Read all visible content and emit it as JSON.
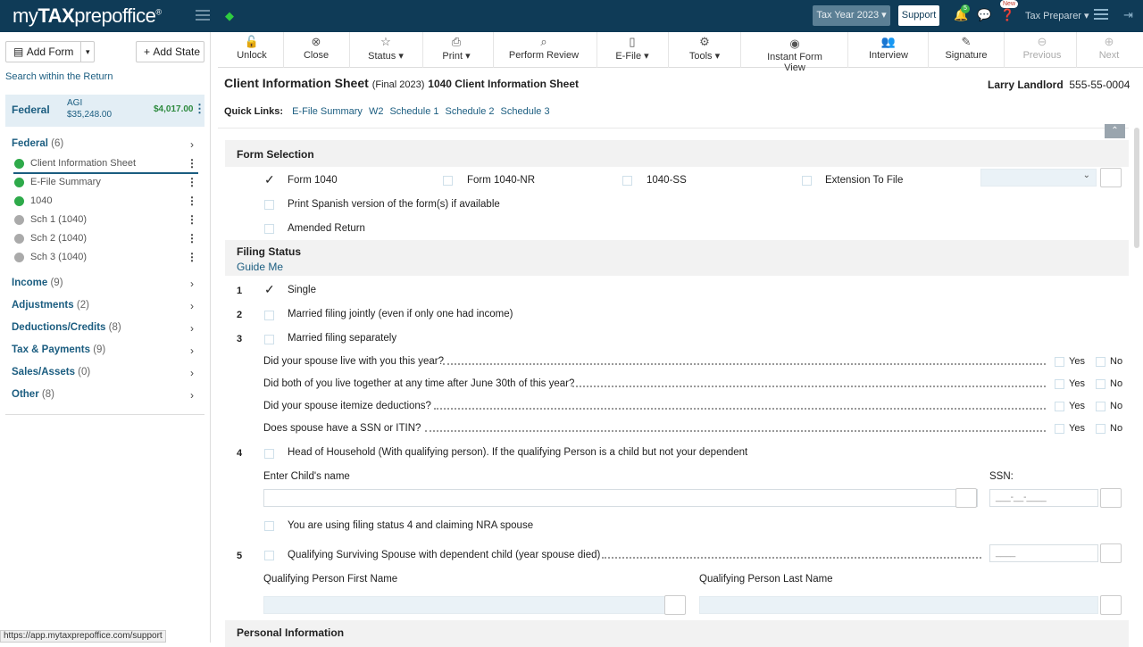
{
  "topbar": {
    "logo_pre": "my",
    "logo_mid": "TAX",
    "logo_post": "prepoffice",
    "logo_mark": "®",
    "tax_year": "Tax Year 2023 ▾",
    "support": "Support",
    "notif_count": "5",
    "new_label": "New",
    "preparer": "Tax Preparer ▾"
  },
  "sidebar": {
    "add_form": "Add Form",
    "add_state": "Add State",
    "search": "Search within the Return",
    "federal": {
      "title": "Federal",
      "agi_label": "AGI",
      "agi_value": "$35,248.00",
      "refund": "$4,017.00"
    },
    "federal_cat": {
      "label": "Federal",
      "count": "(6)"
    },
    "forms": [
      {
        "label": "Client Information Sheet",
        "status": "green"
      },
      {
        "label": "E-File Summary",
        "status": "green"
      },
      {
        "label": "1040",
        "status": "green"
      },
      {
        "label": "Sch 1 (1040)",
        "status": "gray"
      },
      {
        "label": "Sch 2 (1040)",
        "status": "gray"
      },
      {
        "label": "Sch 3 (1040)",
        "status": "gray"
      }
    ],
    "categories": [
      {
        "label": "Income",
        "count": "(9)"
      },
      {
        "label": "Adjustments",
        "count": "(2)"
      },
      {
        "label": "Deductions/Credits",
        "count": "(8)"
      },
      {
        "label": "Tax & Payments",
        "count": "(9)"
      },
      {
        "label": "Sales/Assets",
        "count": "(0)"
      },
      {
        "label": "Other",
        "count": "(8)"
      }
    ]
  },
  "toolbar": {
    "unlock": "Unlock",
    "close": "Close",
    "status": "Status ▾",
    "print": "Print ▾",
    "review": "Perform Review",
    "efile": "E-File ▾",
    "tools": "Tools ▾",
    "instant": "Instant Form View",
    "interview": "Interview",
    "signature": "Signature",
    "previous": "Previous",
    "next": "Next"
  },
  "header": {
    "title": "Client Information Sheet",
    "final": "(Final 2023)",
    "subtitle": "1040 Client Information Sheet",
    "client_name": "Larry Landlord",
    "client_phone": "555-55-0004",
    "quick_label": "Quick Links:",
    "quick_links": [
      "E-File Summary",
      "W2",
      "Schedule 1",
      "Schedule 2",
      "Schedule 3"
    ]
  },
  "form_selection": {
    "heading": "Form Selection",
    "form1040": "Form 1040",
    "form1040nr": "Form 1040-NR",
    "ss": "1040-SS",
    "extension": "Extension To File",
    "spanish": "Print Spanish version of the form(s) if available",
    "amended": "Amended Return"
  },
  "filing": {
    "heading": "Filing Status",
    "guide": "Guide Me",
    "single": "Single",
    "mfj": "Married filing jointly (even if only one had income)",
    "mfs": "Married filing separately",
    "q1": "Did your spouse live with you this year?",
    "q2": "Did both of you live together at any time after June 30th of this year?",
    "q3": "Did your spouse itemize deductions?",
    "q4": "Does spouse have a SSN or ITIN?",
    "yes": "Yes",
    "no": "No",
    "hoh": "Head of Household (With qualifying person). If the qualifying Person is a child but not your dependent",
    "child_name": "Enter Child's name",
    "ssn": "SSN:",
    "ssn_mask": "___-__-____",
    "nra": "You are using filing status 4 and claiming NRA spouse",
    "qss": "Qualifying Surviving Spouse with dependent child (year spouse died)",
    "year_mask": "____",
    "qp_first": "Qualifying Person First Name",
    "qp_last": "Qualifying Person Last Name",
    "n1": "1",
    "n2": "2",
    "n3": "3",
    "n4": "4",
    "n5": "5"
  },
  "personal": {
    "heading": "Personal Information"
  },
  "statusbar": {
    "url": "https://app.mytaxprepoffice.com/support"
  }
}
